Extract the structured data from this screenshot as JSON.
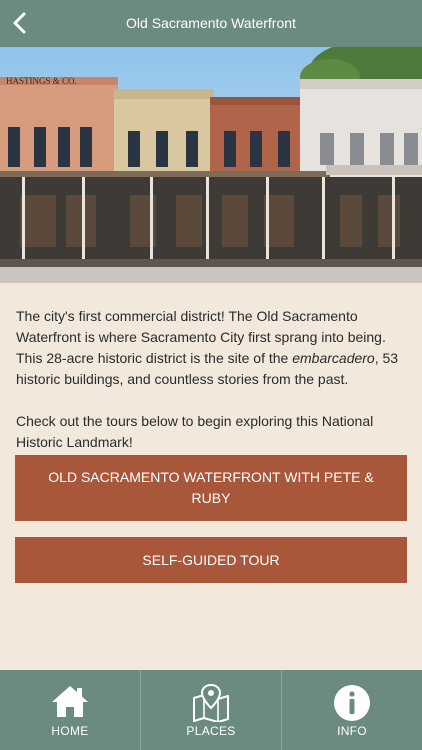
{
  "nav": {
    "title": "Old Sacramento Waterfront",
    "back_icon": "chevron-left-icon"
  },
  "hero": {
    "sign_text": "HASTINGS & CO."
  },
  "intro": {
    "text_before": "The city's first commercial district! The Old Sacramento Waterfront is where Sacramento City first sprang into being. This 28-acre historic district is the site of the ",
    "emphasis": "embarcadero",
    "text_after": ", 53 historic buildings, and countless stories from the past.",
    "cta": "Check out the tours below to begin exploring this National Historic Landmark!"
  },
  "tours": [
    {
      "label": "OLD SACRAMENTO WATERFRONT WITH PETE & RUBY"
    },
    {
      "label": "SELF-GUIDED TOUR"
    }
  ],
  "tabbar": {
    "items": [
      {
        "label": "HOME",
        "icon": "home-icon"
      },
      {
        "label": "PLACES",
        "icon": "map-pin-icon"
      },
      {
        "label": "INFO",
        "icon": "info-icon"
      }
    ]
  },
  "colors": {
    "nav_bg": "#6b8b80",
    "button_bg": "#a8573a",
    "page_bg": "#f2e8dc"
  }
}
